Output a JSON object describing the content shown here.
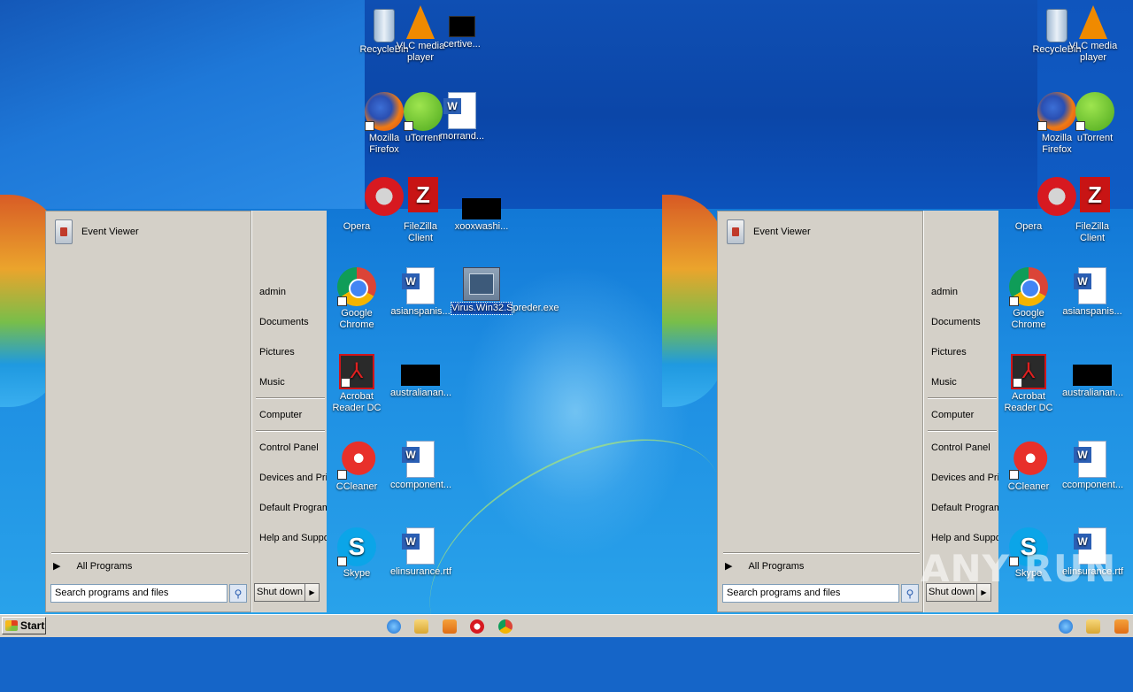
{
  "desktop": {
    "top_left_icons": [
      {
        "id": "recycle",
        "label": "RecycleBin"
      },
      {
        "id": "vlc",
        "label": "VLC media player"
      },
      {
        "id": "certive",
        "label": "certive..."
      },
      {
        "id": "firefox",
        "label": "Mozilla Firefox"
      },
      {
        "id": "utorrent",
        "label": "uTorrent"
      },
      {
        "id": "morrand",
        "label": "morrand..."
      },
      {
        "id": "opera",
        "label": "Opera"
      },
      {
        "id": "filezilla",
        "label": "FileZilla Client"
      },
      {
        "id": "xooxwashi",
        "label": "xooxwashi..."
      }
    ],
    "labels": {
      "recycle": "RecycleBin",
      "vlc": "VLC media player",
      "certive": "certive...",
      "firefox": "Mozilla Firefox",
      "utorrent": "uTorrent",
      "morrand": "morrand...",
      "opera": "Opera",
      "filezilla": "FileZilla Client",
      "xooxwashi": "xooxwashi...",
      "chrome": "Google Chrome",
      "asianspanis": "asianspanis...",
      "virus": "Virus.Win32.Spreder.exe",
      "acrobat": "Acrobat Reader DC",
      "australianan": "australianan...",
      "ccleaner": "CCleaner",
      "ccomponent": "ccomponent...",
      "skype": "Skype",
      "elinsurance": "elinsurance.rtf"
    }
  },
  "start_menu": {
    "pinned_item": "Event Viewer",
    "all_programs": "All Programs",
    "search_placeholder": "Search programs and files",
    "right_items": [
      "admin",
      "Documents",
      "Pictures",
      "Music",
      "Computer",
      "Control Panel",
      "Devices and Printers",
      "Default Programs",
      "Help and Support"
    ],
    "shutdown": "Shut down"
  },
  "taskbar": {
    "start": "Start"
  },
  "watermark": "ANY RUN"
}
